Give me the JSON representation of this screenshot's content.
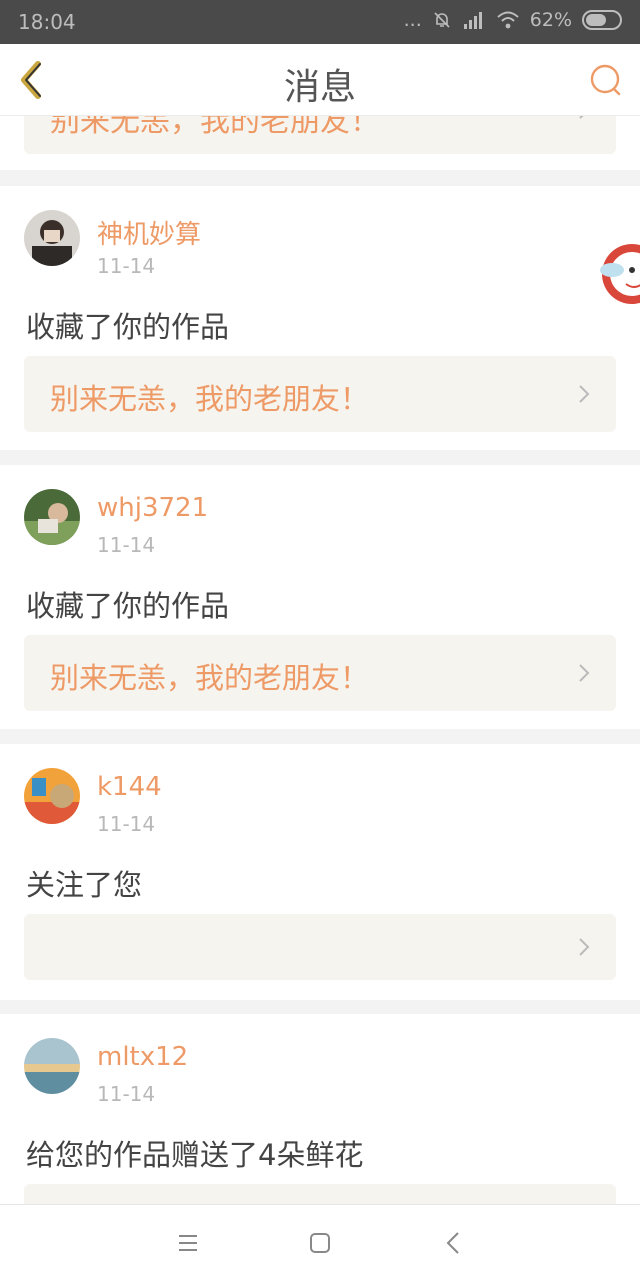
{
  "status_bar": {
    "time": "18:04",
    "dots": "...",
    "battery": "62%",
    "battery_level": 0.62
  },
  "header": {
    "title": "消息",
    "back_icon": "chevron-left-icon",
    "search_icon": "search-icon"
  },
  "partial_item": {
    "reply_text": "别来无恙，我的老朋友！"
  },
  "messages": [
    {
      "user": "神机妙算",
      "date": "11-14",
      "action": "收藏了你的作品",
      "reply_text": "别来无恙，我的老朋友！"
    },
    {
      "user": "whj3721",
      "date": "11-14",
      "action": "收藏了你的作品",
      "reply_text": "别来无恙，我的老朋友！"
    },
    {
      "user": "k144",
      "date": "11-14",
      "action": "关注了您",
      "reply_text": ""
    },
    {
      "user": "mltx12",
      "date": "11-14",
      "action": "给您的作品赠送了4朵鲜花",
      "reply_text": ""
    }
  ],
  "nav": {
    "menu_icon": "menu-icon",
    "home_icon": "home-square-icon",
    "back_icon": "back-triangle-icon"
  },
  "colors": {
    "accent": "#ee9a66",
    "status_bar": "#4a4a4a",
    "reply_box": "#f5f4ef"
  }
}
